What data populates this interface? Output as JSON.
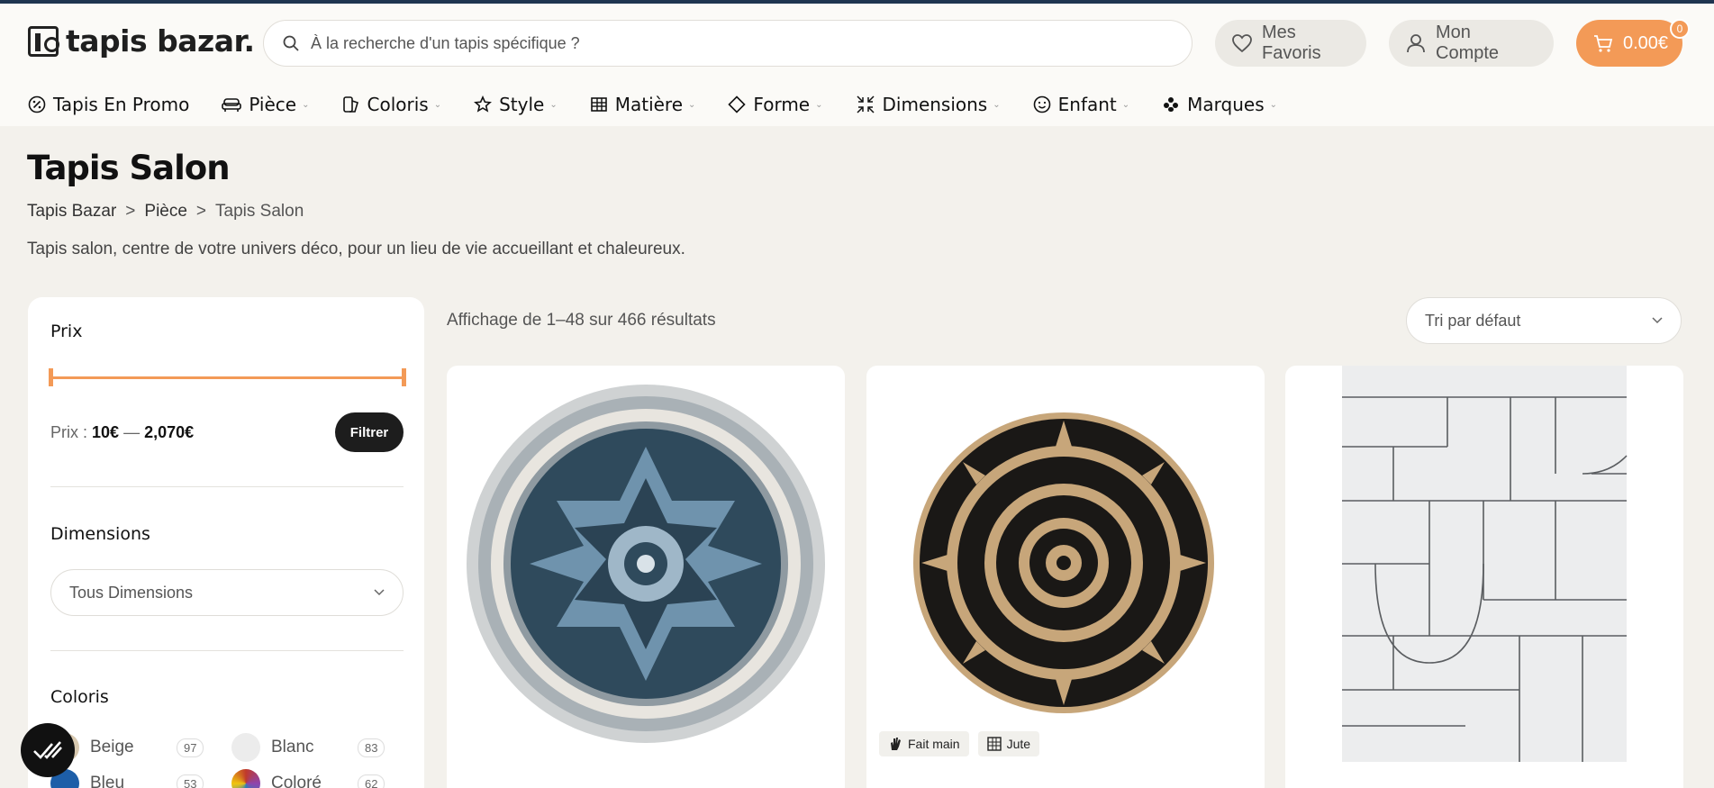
{
  "header": {
    "logo_text": "tapis bazar.",
    "search_placeholder": "À la recherche d'un tapis spécifique ?",
    "favorites_label": "Mes Favoris",
    "account_label": "Mon Compte",
    "cart_total": "0.00€",
    "cart_count": "0",
    "accent_color": "#f39a57"
  },
  "nav": {
    "items": [
      {
        "label": "Tapis En Promo",
        "icon": "percent-badge-icon"
      },
      {
        "label": "Pièce",
        "icon": "sofa-icon"
      },
      {
        "label": "Coloris",
        "icon": "palette-icon"
      },
      {
        "label": "Style",
        "icon": "star-icon"
      },
      {
        "label": "Matière",
        "icon": "weave-icon"
      },
      {
        "label": "Forme",
        "icon": "diamond-icon"
      },
      {
        "label": "Dimensions",
        "icon": "resize-icon"
      },
      {
        "label": "Enfant",
        "icon": "smiley-icon"
      },
      {
        "label": "Marques",
        "icon": "brand-icon"
      }
    ]
  },
  "page": {
    "title": "Tapis Salon",
    "breadcrumb": [
      "Tapis Bazar",
      "Pièce",
      "Tapis Salon"
    ],
    "breadcrumb_sep": ">",
    "intro": "Tapis salon, centre de votre univers déco, pour un lieu de vie accueillant et chaleureux."
  },
  "filters": {
    "price_title": "Prix",
    "price_prefix": "Prix :",
    "price_min": "10€",
    "price_dash": "—",
    "price_max": "2,070€",
    "filter_button": "Filtrer",
    "dimensions_title": "Dimensions",
    "dimensions_value": "Tous Dimensions",
    "colors_title": "Coloris",
    "colors": [
      {
        "name": "Beige",
        "count": "97",
        "swatch": "#d8c9b0"
      },
      {
        "name": "Blanc",
        "count": "83",
        "swatch": "#ececec"
      },
      {
        "name": "Bleu",
        "count": "53",
        "swatch": "#1d5ea8"
      },
      {
        "name": "Coloré",
        "count": "62",
        "swatch": "#c0392b"
      }
    ]
  },
  "listing": {
    "results_text": "Affichage de 1–48 sur 466 résultats",
    "sort_value": "Tri par défaut",
    "product_tags": [
      "Fait main",
      "Jute"
    ]
  }
}
